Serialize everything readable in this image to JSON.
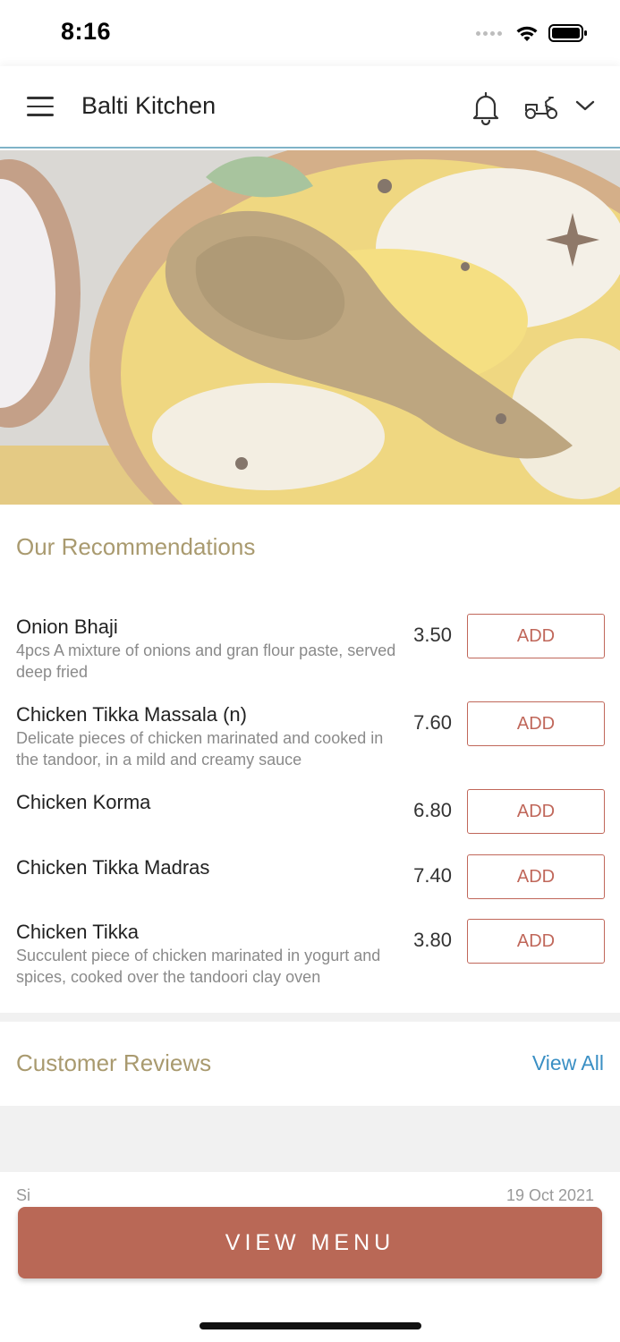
{
  "status_bar": {
    "time": "8:16"
  },
  "header": {
    "title": "Balti Kitchen"
  },
  "recommendations": {
    "title": "Our Recommendations",
    "add_label": "ADD",
    "items": [
      {
        "name": "Onion Bhaji",
        "description": "4pcs A mixture of onions and gran flour paste, served deep fried",
        "price": "3.50"
      },
      {
        "name": "Chicken Tikka Massala (n)",
        "description": "Delicate pieces of chicken marinated and cooked in the tandoor, in a mild and creamy sauce",
        "price": "7.60"
      },
      {
        "name": "Chicken Korma",
        "description": "",
        "price": "6.80"
      },
      {
        "name": "Chicken Tikka Madras",
        "description": "",
        "price": "7.40"
      },
      {
        "name": "Chicken Tikka",
        "description": "Succulent piece of chicken marinated in yogurt and spices, cooked over the tandoori clay oven",
        "price": "3.80"
      }
    ]
  },
  "reviews": {
    "title": "Customer Reviews",
    "view_all": "View All",
    "first_name_partial": "Si",
    "first_date_partial": "19 Oct 2021"
  },
  "footer": {
    "view_menu": "VIEW MENU"
  }
}
